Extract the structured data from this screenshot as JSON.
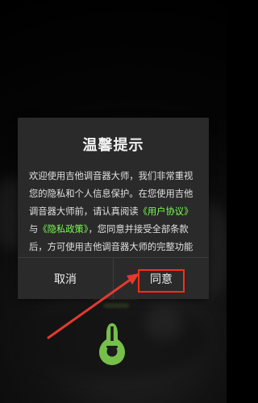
{
  "dialog": {
    "title": "温馨提示",
    "message": {
      "part1": "欢迎使用吉他调音器大师，我们非常重视您的隐私和个人信息保护。在您使用吉他调音器大师前，请认真阅读",
      "link1": "《用户协议》",
      "part2": "与",
      "link2": "《隐私政策》",
      "part3": "，您同意并接受全部条款后，方可使用吉他调音器大师的完整功能"
    },
    "buttons": {
      "cancel": "取消",
      "agree": "同意"
    }
  },
  "colors": {
    "dialog_background": "#2a2a2a",
    "link": "#79ff4e",
    "highlight_border": "#ff2d16",
    "arrow": "#e33a2f",
    "logo_green": "#76bf4b"
  },
  "icons": {
    "app_logo": "guitar-logo-icon",
    "annotation_arrow": "arrow-icon"
  }
}
